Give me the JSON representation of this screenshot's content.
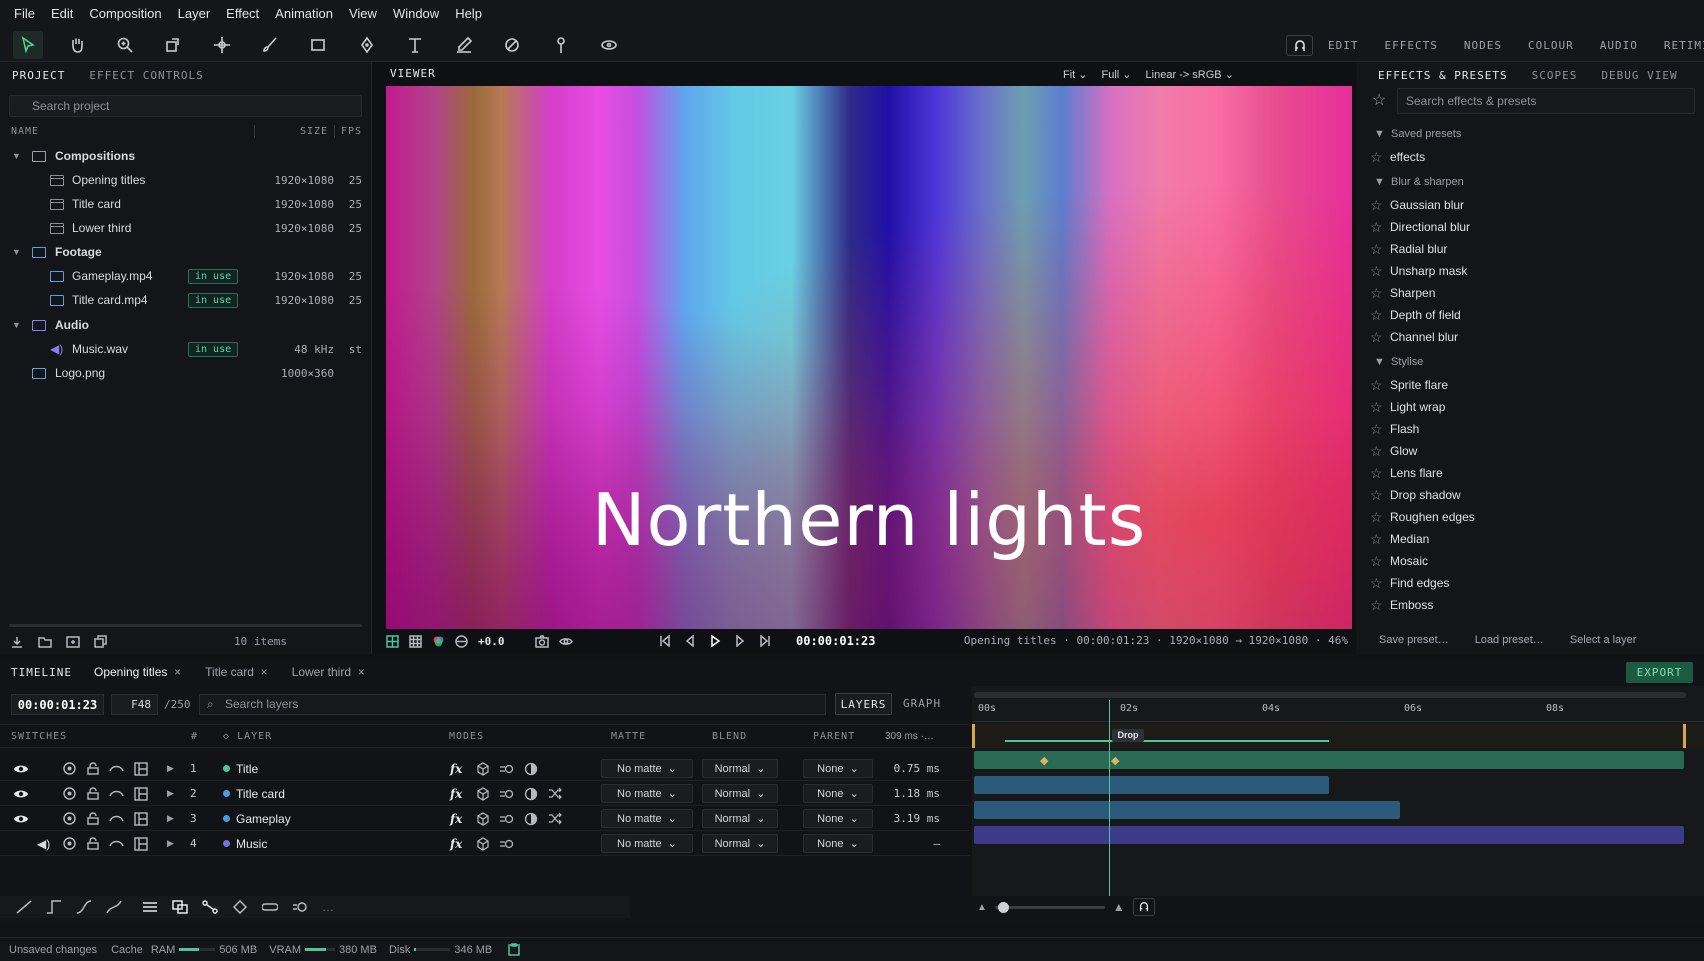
{
  "menu": [
    "File",
    "Edit",
    "Composition",
    "Layer",
    "Effect",
    "Animation",
    "View",
    "Window",
    "Help"
  ],
  "workspaces": [
    "EDIT",
    "EFFECTS",
    "NODES",
    "COLOUR",
    "AUDIO",
    "RETIMING"
  ],
  "left_panel": {
    "tabs": [
      "PROJECT",
      "EFFECT CONTROLS"
    ],
    "search_placeholder": "Search project",
    "col_name": "NAME",
    "col_size": "SIZE",
    "col_fps": "FPS",
    "items": [
      {
        "name": "Compositions",
        "size": "",
        "fps": "",
        "badge": ""
      },
      {
        "name": "Opening titles",
        "size": "1920×1080",
        "fps": "25",
        "badge": ""
      },
      {
        "name": "Title card",
        "size": "1920×1080",
        "fps": "25",
        "badge": ""
      },
      {
        "name": "Lower third",
        "size": "1920×1080",
        "fps": "25",
        "badge": ""
      },
      {
        "name": "Footage",
        "size": "",
        "fps": "",
        "badge": ""
      },
      {
        "name": "Gameplay.mp4",
        "size": "1920×1080",
        "fps": "25",
        "badge": "in use"
      },
      {
        "name": "Title card.mp4",
        "size": "1920×1080",
        "fps": "25",
        "badge": "in use"
      },
      {
        "name": "Audio",
        "size": "",
        "fps": "",
        "badge": ""
      },
      {
        "name": "Music.wav",
        "size": "48 kHz",
        "fps": "st",
        "badge": "in use"
      },
      {
        "name": "Logo.png",
        "size": "1000×360",
        "fps": "",
        "badge": ""
      }
    ],
    "item_count": "10 items"
  },
  "viewer": {
    "label": "VIEWER",
    "fit": "Fit",
    "res": "Full",
    "colorspace": "Linear -> sRGB",
    "title_text": "Northern lights",
    "exposure": "+0.0",
    "timecode": "00:00:01:23",
    "info": "Opening titles · 00:00:01:23 · 1920×1080 → 1920×1080 · 46%"
  },
  "right_panel": {
    "tabs": [
      "EFFECTS & PRESETS",
      "SCOPES",
      "DEBUG VIEW"
    ],
    "search_placeholder": "Search effects & presets",
    "groups": [
      {
        "name": "Saved presets",
        "items": [
          "effects"
        ]
      },
      {
        "name": "Blur & sharpen",
        "items": [
          "Gaussian blur",
          "Directional blur",
          "Radial blur",
          "Unsharp mask",
          "Sharpen",
          "Depth of field",
          "Channel blur"
        ]
      },
      {
        "name": "Stylise",
        "items": [
          "Sprite flare",
          "Light wrap",
          "Flash",
          "Glow",
          "Lens flare",
          "Drop shadow",
          "Roughen edges",
          "Median",
          "Mosaic",
          "Find edges",
          "Emboss"
        ]
      }
    ],
    "footer": [
      "Save preset…",
      "Load preset…",
      "Select a layer"
    ]
  },
  "timeline": {
    "label": "TIMELINE",
    "tabs": [
      "Opening titles",
      "Title card",
      "Lower third"
    ],
    "export": "EXPORT",
    "timecode": "00:00:01:23",
    "frame": "F48",
    "total": "/250",
    "search_placeholder": "Search layers",
    "view_tabs": [
      "LAYERS",
      "GRAPH"
    ],
    "headers": {
      "switches": "SWITCHES",
      "num": "#",
      "layer": "LAYER",
      "modes": "MODES",
      "matte": "MATTE",
      "blend": "BLEND",
      "parent": "PARENT",
      "time": "309 ms ·…"
    },
    "layers": [
      {
        "num": "1",
        "name": "Title",
        "color": "#4ec49a",
        "matte": "No matte",
        "blend": "Normal",
        "parent": "None",
        "time": "0.75 ms"
      },
      {
        "num": "2",
        "name": "Title card",
        "color": "#4a9be0",
        "matte": "No matte",
        "blend": "Normal",
        "parent": "None",
        "time": "1.18 ms"
      },
      {
        "num": "3",
        "name": "Gameplay",
        "color": "#4a9be0",
        "matte": "No matte",
        "blend": "Normal",
        "parent": "None",
        "time": "3.19 ms"
      },
      {
        "num": "4",
        "name": "Music",
        "color": "#7a6fe0",
        "matte": "No matte",
        "blend": "Normal",
        "parent": "None",
        "time": "–"
      }
    ],
    "ruler": [
      "00s",
      "02s",
      "04s",
      "06s",
      "08s"
    ],
    "marker": "Drop"
  },
  "status": {
    "unsaved": "Unsaved changes",
    "cache": "Cache",
    "ram_label": "RAM",
    "ram": "506 MB",
    "ram_fill": 0.55,
    "vram_label": "VRAM",
    "vram": "380 MB",
    "vram_fill": 0.7,
    "disk_label": "Disk",
    "disk": "346 MB",
    "disk_fill": 0.05
  }
}
